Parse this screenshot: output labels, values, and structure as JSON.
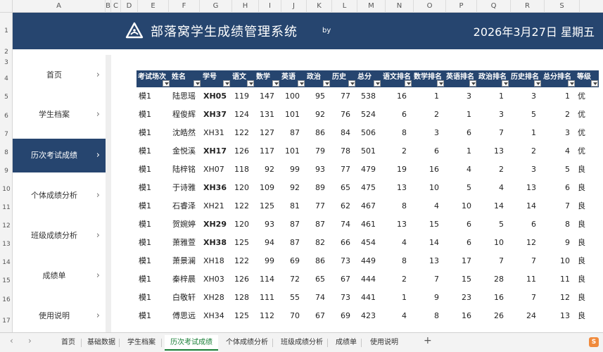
{
  "spreadsheet": {
    "columns": [
      "A",
      "B",
      "C",
      "D",
      "E",
      "F",
      "G",
      "H",
      "I",
      "J",
      "K",
      "L",
      "M",
      "N",
      "O",
      "P",
      "Q",
      "R",
      "S"
    ],
    "rows": [
      "1",
      "2",
      "3",
      "4",
      "5",
      "6",
      "7",
      "8",
      "9",
      "10",
      "11",
      "12",
      "13",
      "14",
      "15",
      "16",
      "17"
    ]
  },
  "banner": {
    "title": "部落窝学生成绩管理系统",
    "by": "by",
    "date": "2026年3月27日 星期五",
    "logo_icon": "graduation-triangle-icon"
  },
  "sidebar": {
    "items": [
      {
        "label": "首页",
        "active": false
      },
      {
        "label": "学生档案",
        "active": false
      },
      {
        "label": "历次考试成绩",
        "active": true
      },
      {
        "label": "个体成绩分析",
        "active": false
      },
      {
        "label": "班级成绩分析",
        "active": false
      },
      {
        "label": "成绩单",
        "active": false
      },
      {
        "label": "使用说明",
        "active": false
      }
    ],
    "chevron": "›"
  },
  "table": {
    "headers": [
      "考试场次",
      "姓名",
      "学号",
      "语文",
      "数学",
      "英语",
      "政治",
      "历史",
      "总分",
      "语文排名",
      "数学排名",
      "英语排名",
      "政治排名",
      "历史排名",
      "总分排名",
      "等级"
    ],
    "rows": [
      [
        "模1",
        "陆思瑶",
        "XH05",
        "119",
        "147",
        "100",
        "95",
        "77",
        "538",
        "16",
        "1",
        "3",
        "1",
        "3",
        "1",
        "优"
      ],
      [
        "模1",
        "程俊辉",
        "XH37",
        "124",
        "131",
        "101",
        "92",
        "76",
        "524",
        "6",
        "2",
        "1",
        "3",
        "5",
        "2",
        "优"
      ],
      [
        "模1",
        "沈皓然",
        "XH31",
        "122",
        "127",
        "87",
        "86",
        "84",
        "506",
        "8",
        "3",
        "6",
        "7",
        "1",
        "3",
        "优"
      ],
      [
        "模1",
        "金悦溪",
        "XH17",
        "126",
        "117",
        "101",
        "79",
        "78",
        "501",
        "2",
        "6",
        "1",
        "13",
        "2",
        "4",
        "优"
      ],
      [
        "模1",
        "陆梓铭",
        "XH07",
        "118",
        "92",
        "99",
        "93",
        "77",
        "479",
        "19",
        "16",
        "4",
        "2",
        "3",
        "5",
        "良"
      ],
      [
        "模1",
        "于诗雅",
        "XH36",
        "120",
        "109",
        "92",
        "89",
        "65",
        "475",
        "13",
        "10",
        "5",
        "4",
        "13",
        "6",
        "良"
      ],
      [
        "模1",
        "石睿泽",
        "XH21",
        "122",
        "125",
        "81",
        "77",
        "62",
        "467",
        "8",
        "4",
        "10",
        "14",
        "14",
        "7",
        "良"
      ],
      [
        "模1",
        "贺婉婷",
        "XH29",
        "120",
        "93",
        "87",
        "87",
        "74",
        "461",
        "13",
        "15",
        "6",
        "5",
        "6",
        "8",
        "良"
      ],
      [
        "模1",
        "萧雅萱",
        "XH38",
        "125",
        "94",
        "87",
        "82",
        "66",
        "454",
        "4",
        "14",
        "6",
        "10",
        "12",
        "9",
        "良"
      ],
      [
        "模1",
        "萧景澜",
        "XH18",
        "122",
        "99",
        "69",
        "86",
        "73",
        "449",
        "8",
        "13",
        "17",
        "7",
        "7",
        "10",
        "良"
      ],
      [
        "模1",
        "秦梓晨",
        "XH03",
        "126",
        "114",
        "72",
        "65",
        "67",
        "444",
        "2",
        "7",
        "15",
        "28",
        "11",
        "11",
        "良"
      ],
      [
        "模1",
        "白敬轩",
        "XH28",
        "128",
        "111",
        "55",
        "74",
        "73",
        "441",
        "1",
        "9",
        "23",
        "16",
        "7",
        "12",
        "良"
      ],
      [
        "模1",
        "傅思远",
        "XH34",
        "125",
        "112",
        "70",
        "67",
        "69",
        "423",
        "4",
        "8",
        "16",
        "26",
        "24",
        "13",
        "良"
      ]
    ]
  },
  "sheet_tabs": {
    "nav_prev": "‹",
    "nav_next": "›",
    "tabs": [
      {
        "label": "首页",
        "active": false
      },
      {
        "label": "基础数据",
        "active": false
      },
      {
        "label": "学生档案",
        "active": false
      },
      {
        "label": "历次考试成绩",
        "active": true
      },
      {
        "label": "个体成绩分析",
        "active": false
      },
      {
        "label": "班级成绩分析",
        "active": false
      },
      {
        "label": "成绩单",
        "active": false
      },
      {
        "label": "使用说明",
        "active": false
      }
    ],
    "add": "+",
    "badge": "S"
  },
  "colors": {
    "primary": "#26456f",
    "active_tab": "#1a7f37"
  }
}
